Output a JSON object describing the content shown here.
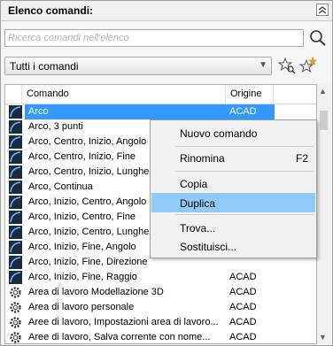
{
  "header": {
    "title": "Elenco comandi:"
  },
  "search": {
    "placeholder": "Ricerca comandi nell'elenco"
  },
  "filter": {
    "selected": "Tutti i comandi"
  },
  "columns": {
    "command": "Comando",
    "origin": "Origine"
  },
  "rows": [
    {
      "name": "Arco",
      "origin": "ACAD",
      "icon": "arc-icon",
      "selected": true
    },
    {
      "name": "Arco, 3 punti",
      "origin": "",
      "icon": "arc-icon"
    },
    {
      "name": "Arco, Centro, Inizio, Angolo",
      "origin": "",
      "icon": "arc-icon"
    },
    {
      "name": "Arco, Centro, Inizio, Fine",
      "origin": "",
      "icon": "arc-icon"
    },
    {
      "name": "Arco, Centro, Inizio, Lunghez",
      "origin": "",
      "icon": "arc-icon"
    },
    {
      "name": "Arco, Continua",
      "origin": "",
      "icon": "arc-icon"
    },
    {
      "name": "Arco, Inizio, Centro, Angolo",
      "origin": "",
      "icon": "arc-icon"
    },
    {
      "name": "Arco, Inizio, Centro, Fine",
      "origin": "",
      "icon": "arc-icon"
    },
    {
      "name": "Arco, Inizio, Centro, Lunghez",
      "origin": "",
      "icon": "arc-icon"
    },
    {
      "name": "Arco, Inizio, Fine, Angolo",
      "origin": "",
      "icon": "arc-icon"
    },
    {
      "name": "Arco, Inizio, Fine, Direzione",
      "origin": "",
      "icon": "arc-icon"
    },
    {
      "name": "Arco, Inizio, Fine, Raggio",
      "origin": "ACAD",
      "icon": "arc-icon"
    },
    {
      "name": "Area di lavoro Modellazione 3D",
      "origin": "ACAD",
      "icon": "gear-icon"
    },
    {
      "name": "Area di lavoro personale",
      "origin": "ACAD",
      "icon": "gear-icon"
    },
    {
      "name": "Aree di lavoro, Impostazioni area di lavoro...",
      "origin": "ACAD",
      "icon": "gear-icon"
    },
    {
      "name": "Aree di lavoro, Salva corrente con nome...",
      "origin": "ACAD",
      "icon": "gear-icon"
    }
  ],
  "context_menu": {
    "new_command": "Nuovo comando",
    "rename": "Rinomina",
    "rename_shortcut": "F2",
    "copy": "Copia",
    "duplicate": "Duplica",
    "find": "Trova...",
    "replace": "Sostituisci..."
  },
  "colors": {
    "selection": "#3399ff",
    "menu_hover": "#91c9f7",
    "icon_blue": "#1f5aa6"
  }
}
